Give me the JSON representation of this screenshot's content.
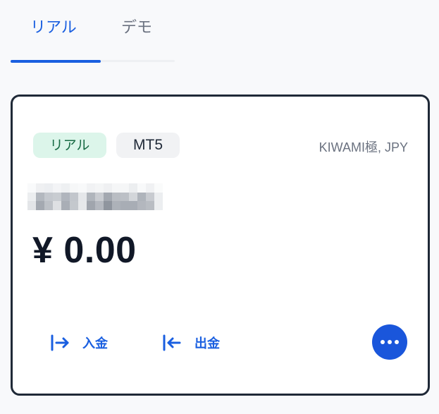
{
  "tabs": [
    {
      "label": "リアル",
      "active": true
    },
    {
      "label": "デモ",
      "active": false
    }
  ],
  "account_card": {
    "badges": {
      "account_type": "リアル",
      "platform": "MT5"
    },
    "server_currency": "KIWAMI極, JPY",
    "account_number": "redacted",
    "balance": "¥ 0.00",
    "actions": {
      "deposit_label": "入金",
      "withdraw_label": "出金",
      "more_icon": "more-horizontal-icon"
    }
  },
  "colors": {
    "accent": "#1a5fe0",
    "real_badge_bg": "#dcf5ea",
    "real_badge_text": "#166a43",
    "card_border": "#1f2937"
  }
}
